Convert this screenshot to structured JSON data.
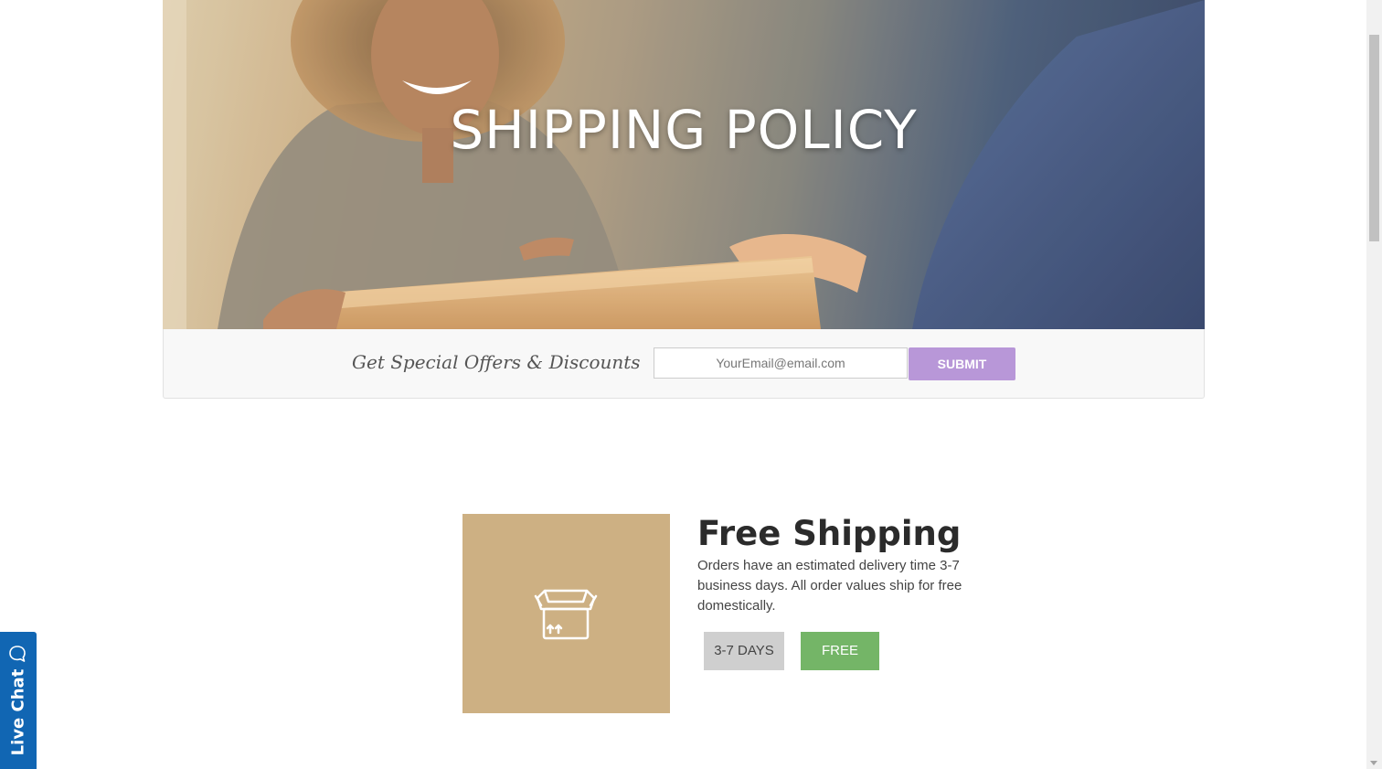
{
  "hero": {
    "title": "SHIPPING POLICY"
  },
  "newsletter": {
    "label": "Get Special Offers & Discounts",
    "email_placeholder": "YourEmail@email.com",
    "submit_label": "SUBMIT"
  },
  "shipping": {
    "icon": "box-icon",
    "title": "Free Shipping",
    "description": "Orders have an estimated delivery time 3-7 business days. All order values ship for free domestically.",
    "days_tag": "3-7 DAYS",
    "price_tag": "FREE"
  },
  "live_chat": {
    "label": "Live Chat",
    "icon": "chat-bubble-icon"
  },
  "colors": {
    "submit_button": "#b897d8",
    "ship_image_bg": "#cdb083",
    "free_tag": "#74b567",
    "days_tag": "#cfcfcf",
    "live_chat": "#1166b3"
  }
}
